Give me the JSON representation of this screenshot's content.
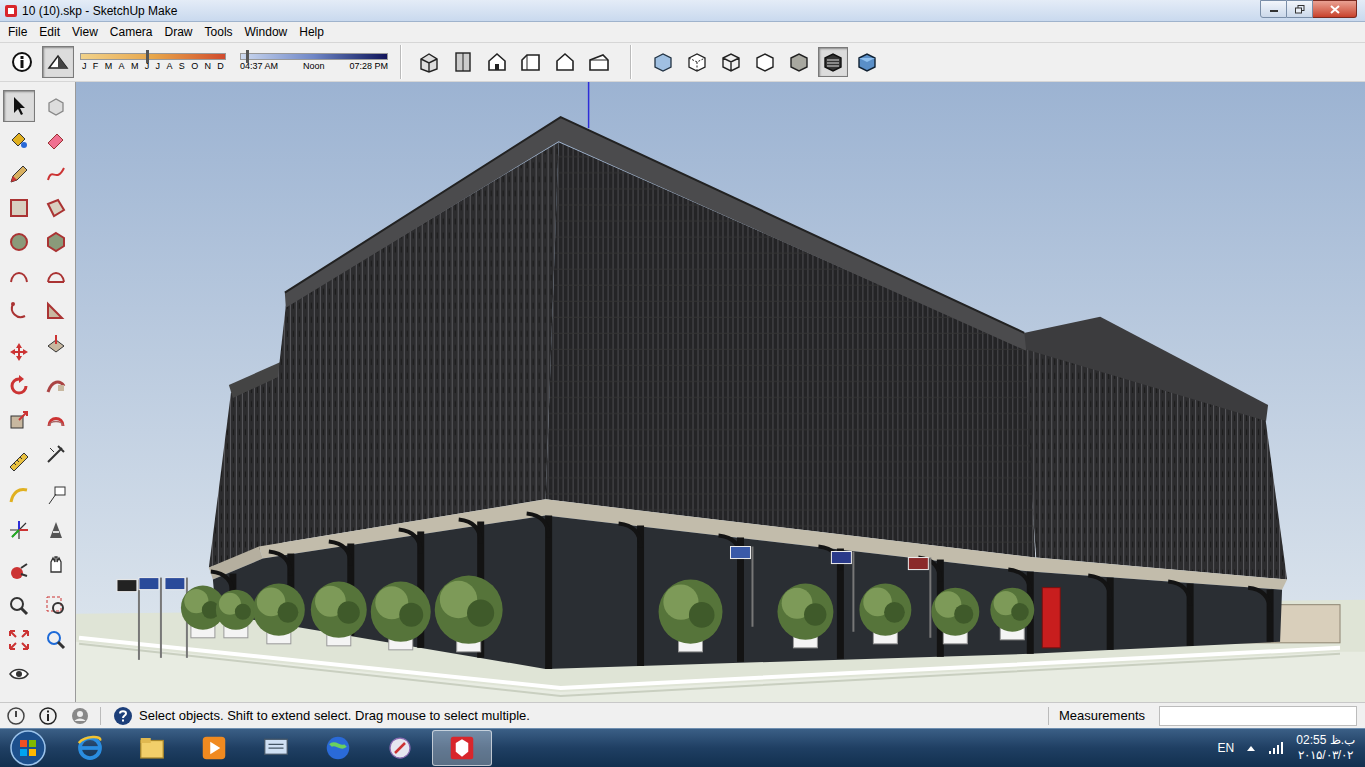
{
  "window": {
    "title": "10 (10).skp - SketchUp Make"
  },
  "menu": [
    "File",
    "Edit",
    "View",
    "Camera",
    "Draw",
    "Tools",
    "Window",
    "Help"
  ],
  "shadow_toggles": [
    {
      "selected": false
    },
    {
      "selected": true
    }
  ],
  "shadow_settings": {
    "months": [
      "J",
      "F",
      "M",
      "A",
      "M",
      "J",
      "J",
      "A",
      "S",
      "O",
      "N",
      "D"
    ],
    "month_level": 0.46,
    "time_start": "04:37 AM",
    "time_noon": "Noon",
    "time_end": "07:28 PM",
    "time_level": 0.04
  },
  "view_buttons": [
    {
      "selected": false
    },
    {
      "selected": false
    },
    {
      "selected": false
    },
    {
      "selected": false
    },
    {
      "selected": false
    },
    {
      "selected": false
    }
  ],
  "style_buttons": [
    {
      "selected": false
    },
    {
      "selected": false
    },
    {
      "selected": false
    },
    {
      "selected": false
    },
    {
      "selected": false
    },
    {
      "selected": true
    },
    {
      "selected": false
    }
  ],
  "left_tools": [
    {
      "selected": true
    },
    {
      "selected": false
    },
    {
      "selected": false
    },
    {
      "selected": false
    },
    {
      "selected": false
    },
    {
      "selected": false
    },
    {
      "selected": false
    },
    {
      "selected": false
    },
    {
      "selected": false
    },
    {
      "selected": false
    },
    {
      "selected": false
    },
    {
      "selected": false
    },
    {
      "selected": false
    },
    {
      "selected": false
    },
    {
      "selected": false
    },
    {
      "selected": false
    },
    {
      "selected": false
    },
    {
      "selected": false
    },
    {
      "selected": false
    },
    {
      "selected": false
    },
    {
      "selected": false
    },
    {
      "selected": false
    },
    {
      "selected": false
    },
    {
      "selected": false
    },
    {
      "selected": false
    },
    {
      "selected": false
    },
    {
      "selected": false
    },
    {
      "selected": false
    },
    {
      "selected": false
    },
    {
      "selected": false
    },
    {
      "selected": false
    },
    {
      "selected": false
    },
    {
      "selected": false
    }
  ],
  "status": {
    "hint": "Select objects. Shift to extend select. Drag mouse to select multiple.",
    "measurements_label": "Measurements",
    "measurements_value": ""
  },
  "taskbar": {
    "apps": [
      {
        "active": false
      },
      {
        "active": false
      },
      {
        "active": false
      },
      {
        "active": false
      },
      {
        "active": false
      },
      {
        "active": false
      },
      {
        "active": true
      }
    ],
    "language": "EN",
    "time": "02:55 ب.ظ",
    "date": "۲۰۱۵/۰۳/۰۲"
  }
}
